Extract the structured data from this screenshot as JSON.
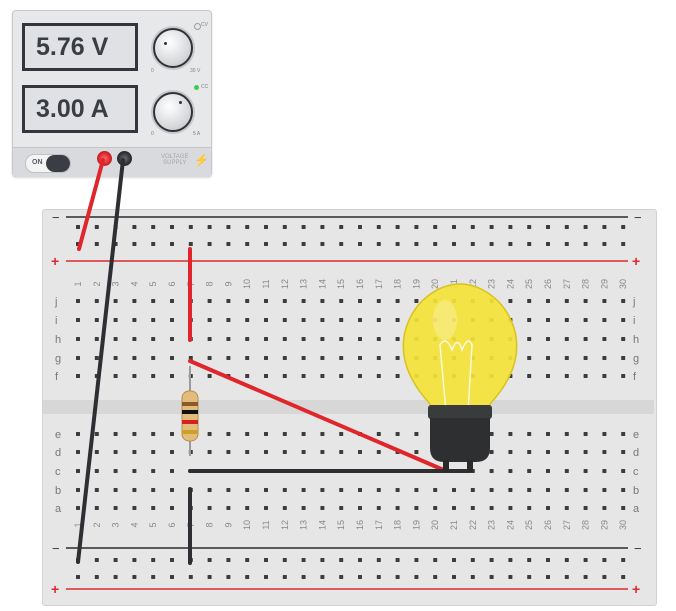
{
  "power_supply": {
    "voltage_display": "5.76 V",
    "current_display": "3.00 A",
    "voltage_mode_label": "CV",
    "current_mode_label": "CC",
    "voltage_min_label": "0",
    "voltage_max_label": "30 V",
    "current_min_label": "0",
    "current_max_label": "5 A",
    "power_switch_label": "ON",
    "brand_line1": "VOLTAGE",
    "brand_line2": "SUPPLY",
    "cc_led_color": "#3ccf4e"
  },
  "breadboard": {
    "rail_minus": "−",
    "rail_plus": "+",
    "column_count": 30,
    "top_row_labels": [
      "j",
      "i",
      "h",
      "g",
      "f"
    ],
    "bottom_row_labels": [
      "e",
      "d",
      "c",
      "b",
      "a"
    ],
    "rail_red": "#d92b2b",
    "rail_dark": "#2b2b2b"
  },
  "components": {
    "resistor_bands": [
      "#8b5a2b",
      "#111111",
      "#d72020",
      "#c9a227"
    ],
    "bulb_glass_color": "#f4e33a",
    "bulb_base_color": "#2e2f31",
    "wire_positive_color": "#e0262b",
    "wire_negative_color": "#2d2f32"
  }
}
